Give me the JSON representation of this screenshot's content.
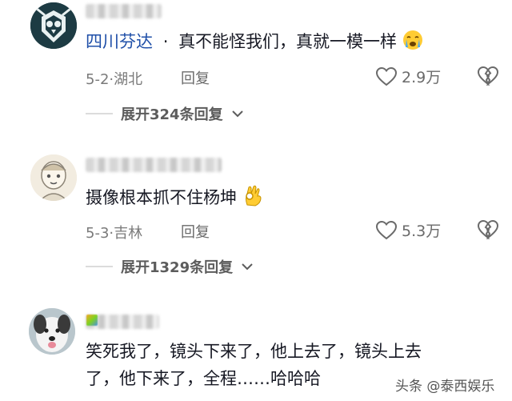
{
  "comments": [
    {
      "tag": "四川芬达",
      "separator": "·",
      "text": "真不能怪我们，真就一模一样",
      "emoji": "crying-emoji",
      "date": "5-2",
      "location": "湖北",
      "reply": "回复",
      "likes": "2.9万",
      "expand": "展开324条回复"
    },
    {
      "text": "摄像根本抓不住杨坤",
      "emoji": "ok-hand-emoji",
      "date": "5-3",
      "location": "吉林",
      "reply": "回复",
      "likes": "5.3万",
      "expand": "展开1329条回复"
    },
    {
      "text_line1": "笑死我了，镜头下来了，他上去了，镜头上去",
      "text_line2": "了，他下来了，全程……哈哈哈"
    }
  ],
  "meta_separator": "·",
  "watermark": "头条 @泰西娱乐",
  "colors": {
    "tag": "#1f4fa8",
    "meta": "#7a7a7a",
    "text": "#161823"
  }
}
